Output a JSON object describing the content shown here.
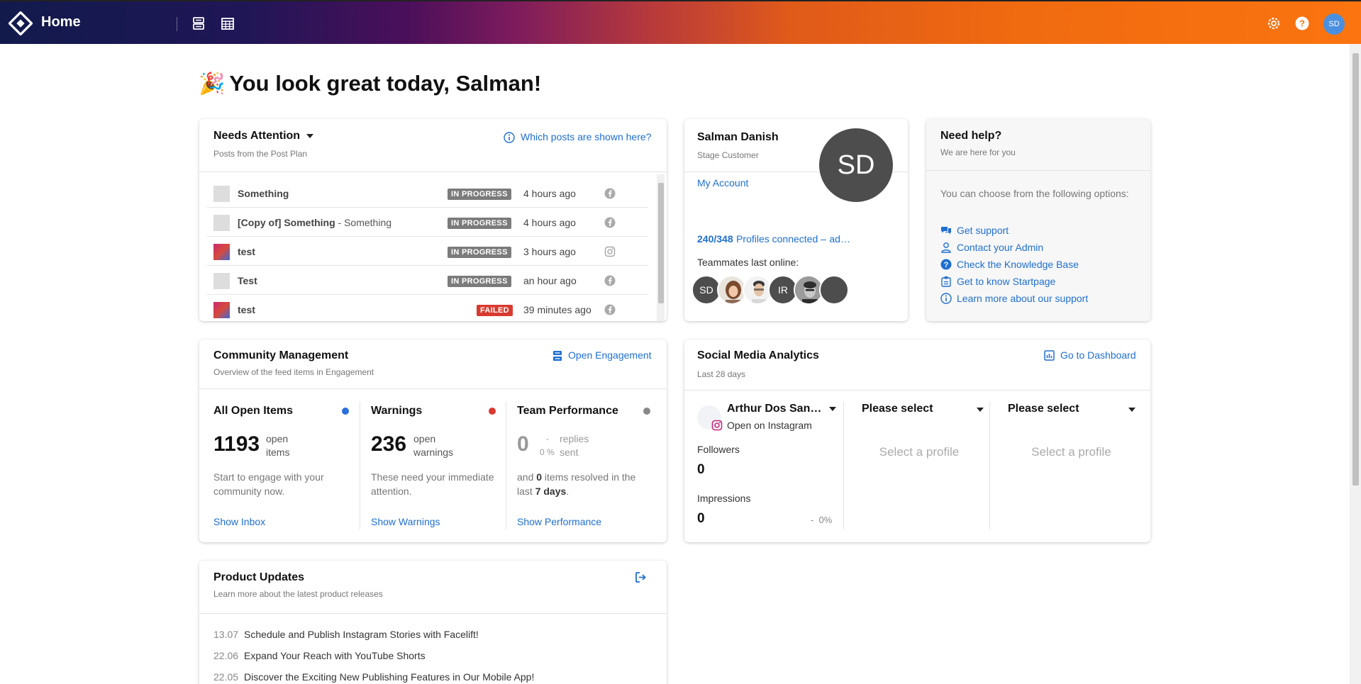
{
  "topbar": {
    "title": "Home",
    "avatar_initials": "SD",
    "icons": [
      "logo-icon",
      "content-list-icon",
      "calendar-icon",
      "settings-icon",
      "help-icon"
    ]
  },
  "greeting": {
    "emoji": "🎉",
    "text": "You look great today, Salman!"
  },
  "needs_attention": {
    "title": "Needs Attention",
    "subtitle": "Posts from the Post Plan",
    "info_link": "Which posts are shown here?",
    "posts": [
      {
        "name": "Something",
        "extra": "",
        "status": "IN PROGRESS",
        "time": "4 hours ago",
        "network": "facebook"
      },
      {
        "name": "[Copy of] Something",
        "extra": " - Something",
        "status": "IN PROGRESS",
        "time": "4 hours ago",
        "network": "facebook"
      },
      {
        "name": "test",
        "extra": "",
        "status": "IN PROGRESS",
        "time": "3 hours ago",
        "network": "instagram"
      },
      {
        "name": "Test",
        "extra": "",
        "status": "IN PROGRESS",
        "time": "an hour ago",
        "network": "facebook"
      },
      {
        "name": "test",
        "extra": "",
        "status": "FAILED",
        "time": "39 minutes ago",
        "network": "facebook"
      }
    ]
  },
  "profile": {
    "name": "Salman Danish",
    "role": "Stage Customer",
    "initials": "SD",
    "account_link": "My Account",
    "profiles_count": "240/348",
    "profiles_text": "Profiles connected –",
    "profiles_more": "ad…",
    "teammates_label": "Teammates last online:",
    "teammates": [
      "SD",
      "",
      "",
      "IR",
      "",
      ""
    ]
  },
  "help": {
    "title": "Need help?",
    "subtitle": "We are here for you",
    "intro": "You can choose from the following options:",
    "items": [
      "Get support",
      "Contact your Admin",
      "Check the Knowledge Base",
      "Get to know Startpage",
      "Learn more about our support"
    ]
  },
  "community": {
    "title": "Community Management",
    "subtitle": "Overview of the feed items in Engagement",
    "open_link": "Open Engagement",
    "columns": [
      {
        "title": "All Open Items",
        "number": "1193",
        "unit": "open items",
        "desc": "Start to engage with your community now.",
        "link": "Show Inbox",
        "color": "#2a6fdb"
      },
      {
        "title": "Warnings",
        "number": "236",
        "unit": "open warnings",
        "desc": "These need your immediate attention.",
        "link": "Show Warnings",
        "color": "#d93a2f"
      },
      {
        "title": "Team Performance",
        "number": "0",
        "dash": "-",
        "percent": "0 %",
        "unit": "replies sent",
        "desc_pre": "and ",
        "desc_num": "0",
        "desc_mid": " items resolved in the last ",
        "desc_days": "7 days",
        "desc_end": ".",
        "link": "Show Performance",
        "color": "#888888"
      }
    ]
  },
  "analytics": {
    "title": "Social Media Analytics",
    "subtitle": "Last 28 days",
    "dashboard_link": "Go to Dashboard",
    "profile_name": "Arthur Dos San…",
    "open_on": "Open on Instagram",
    "followers_label": "Followers",
    "followers_value": "0",
    "impressions_label": "Impressions",
    "impressions_value": "0",
    "impressions_change": "-  0%",
    "select_label": "Please select",
    "select_placeholder": "Select a profile"
  },
  "updates": {
    "title": "Product Updates",
    "subtitle": "Learn more about the latest product releases",
    "items": [
      {
        "date": "13.07",
        "text": "Schedule and Publish Instagram Stories with Facelift!"
      },
      {
        "date": "22.06",
        "text": "Expand Your Reach with YouTube Shorts"
      },
      {
        "date": "22.05",
        "text": "Discover the Exciting New Publishing Features in Our Mobile App!"
      }
    ]
  }
}
